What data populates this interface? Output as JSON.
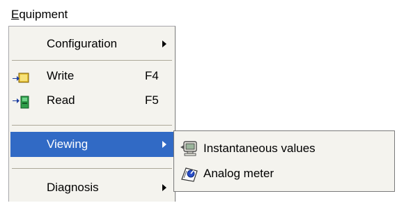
{
  "menubar": {
    "equipment": {
      "accel": "E",
      "rest": "quipment"
    }
  },
  "menu": {
    "items": [
      {
        "label": "Configuration",
        "has_submenu": true
      },
      {
        "label": "Write",
        "shortcut": "F4",
        "icon": "write-icon"
      },
      {
        "label": "Read",
        "shortcut": "F5",
        "icon": "read-icon"
      },
      {
        "label": "Viewing",
        "has_submenu": true,
        "selected": true
      },
      {
        "label": "Diagnosis",
        "has_submenu": true
      }
    ]
  },
  "submenu": {
    "items": [
      {
        "label": "Instantaneous values",
        "icon": "monitor-icon"
      },
      {
        "label": "Analog meter",
        "icon": "analog-meter-icon"
      }
    ]
  },
  "colors": {
    "menu_background": "#f4f3ee",
    "selection": "#316ac5",
    "separator": "#aca899"
  }
}
